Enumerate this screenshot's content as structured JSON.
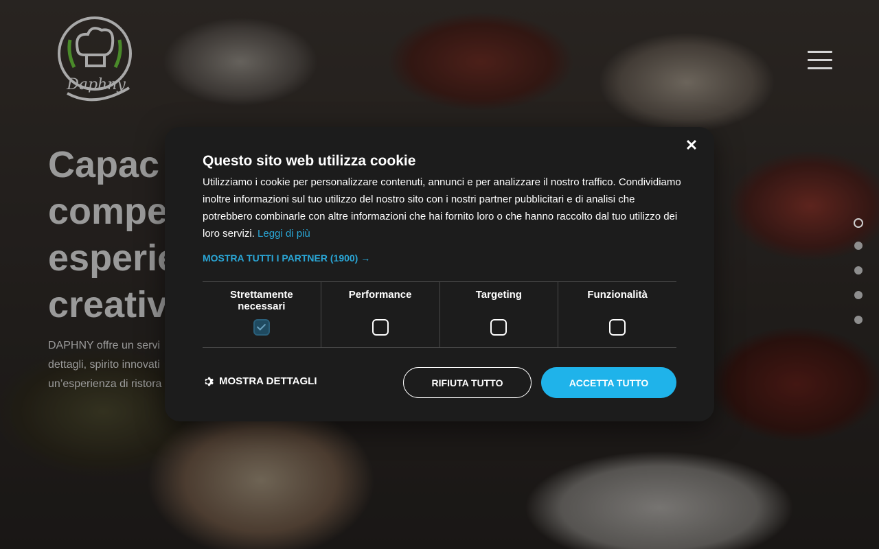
{
  "brand": {
    "logo_text": "Daphny"
  },
  "hero": {
    "title_lines": [
      "Capac",
      "compe",
      "esperie",
      "creativ"
    ],
    "text_lines": [
      "DAPHNY offre un servi",
      "dettagli, spirito innovati",
      "un’esperienza di ristora"
    ]
  },
  "cookie_banner": {
    "title": "Questo sito web utilizza cookie",
    "description": "Utilizziamo i cookie per personalizzare contenuti, annunci e per analizzare il nostro traffico. Condividiamo inoltre informazioni sul tuo utilizzo del nostro sito con i nostri partner pubblicitari e di analisi che potrebbero combinarle con altre informazioni che hai fornito loro o che hanno raccolto dal tuo utilizzo dei loro servizi.",
    "read_more_label": "Leggi di più",
    "partners_label": "MOSTRA TUTTI I PARTNER (1900) →",
    "close_symbol": "✕",
    "categories": [
      {
        "label": "Strettamente necessari",
        "checked": true,
        "disabled": true
      },
      {
        "label": "Performance",
        "checked": false
      },
      {
        "label": "Targeting",
        "checked": false
      },
      {
        "label": "Funzionalità",
        "checked": false
      }
    ],
    "details_label": "MOSTRA DETTAGLI",
    "reject_label": "RIFIUTA TUTTO",
    "accept_label": "ACCETTA TUTTO"
  },
  "slider": {
    "total": 5,
    "active_index": 0
  },
  "colors": {
    "accent": "#1fb3ea",
    "link": "#2aa7d7",
    "modal_bg": "#1c1c1c",
    "logo_green": "#4a8a2a"
  }
}
